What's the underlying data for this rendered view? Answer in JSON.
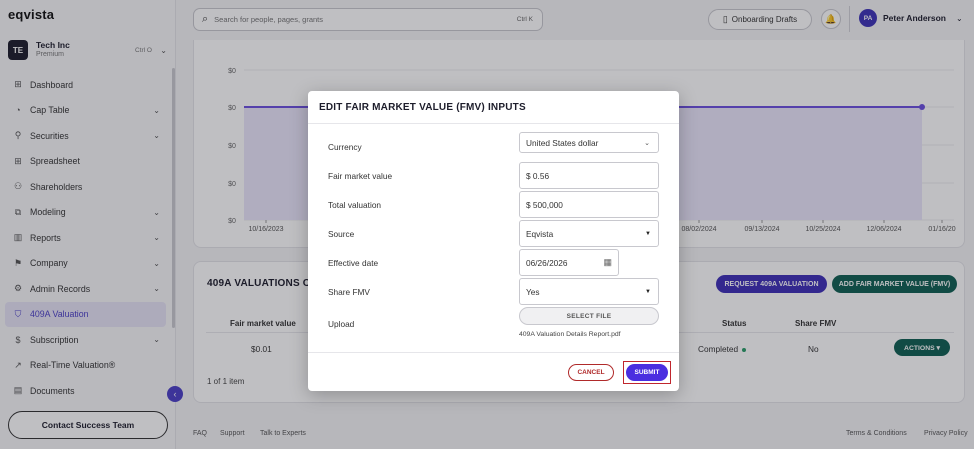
{
  "app": {
    "logo": "eqvista"
  },
  "company": {
    "initials": "TE",
    "name": "Tech Inc",
    "plan": "Premium",
    "shortcut": "Ctrl O"
  },
  "sidebar": {
    "items": [
      {
        "label": "Dashboard",
        "icon": "dashboard-icon",
        "glyph": "⊞",
        "expandable": false,
        "active": false
      },
      {
        "label": "Cap Table",
        "icon": "cap-table-icon",
        "glyph": "◔",
        "expandable": true,
        "active": false
      },
      {
        "label": "Securities",
        "icon": "securities-icon",
        "glyph": "⚲",
        "expandable": true,
        "active": false
      },
      {
        "label": "Spreadsheet",
        "icon": "spreadsheet-icon",
        "glyph": "⊞",
        "expandable": false,
        "active": false
      },
      {
        "label": "Shareholders",
        "icon": "shareholders-icon",
        "glyph": "⚇",
        "expandable": false,
        "active": false
      },
      {
        "label": "Modeling",
        "icon": "modeling-icon",
        "glyph": "⧉",
        "expandable": true,
        "active": false
      },
      {
        "label": "Reports",
        "icon": "reports-icon",
        "glyph": "▥",
        "expandable": true,
        "active": false
      },
      {
        "label": "Company",
        "icon": "company-icon",
        "glyph": "⚑",
        "expandable": true,
        "active": false
      },
      {
        "label": "Admin Records",
        "icon": "admin-records-icon",
        "glyph": "⚙",
        "expandable": true,
        "active": false
      },
      {
        "label": "409A Valuation",
        "icon": "shield-icon",
        "glyph": "⛉",
        "expandable": false,
        "active": true
      },
      {
        "label": "Subscription",
        "icon": "subscription-icon",
        "glyph": "$",
        "expandable": true,
        "active": false
      },
      {
        "label": "Real-Time Valuation®",
        "icon": "trend-icon",
        "glyph": "↗",
        "expandable": false,
        "active": false
      },
      {
        "label": "Documents",
        "icon": "documents-icon",
        "glyph": "▤",
        "expandable": false,
        "active": false
      }
    ],
    "contact_label": "Contact Success Team"
  },
  "header": {
    "search_placeholder": "Search for people, pages, grants",
    "search_shortcut": "Ctrl K",
    "drafts_label": "Onboarding Drafts",
    "user_initials": "PA",
    "user_name": "Peter Anderson"
  },
  "chart_data": {
    "type": "line",
    "x": [
      "10/16/2023",
      "08/02/2024",
      "09/13/2024",
      "10/25/2024",
      "12/06/2024",
      "01/16/20"
    ],
    "y_tick_labels": [
      "$0",
      "$0",
      "$0",
      "$0",
      "$0"
    ],
    "values": [
      0.01,
      0.01,
      0.01,
      0.01,
      0.01,
      0.01
    ],
    "color": "#6b4fe0",
    "fill": "#ebe7fb"
  },
  "valuations": {
    "title": "409A VALUATIONS OVE",
    "request_label": "REQUEST 409A VALUATION",
    "add_fmv_label": "ADD FAIR MARKET VALUE (FMV)",
    "columns": {
      "fmv": "Fair market value",
      "status": "Status",
      "share_fmv": "Share FMV"
    },
    "rows": [
      {
        "fmv": "$0.01",
        "status": "Completed",
        "share_fmv": "No",
        "actions": "ACTIONS ▾"
      }
    ],
    "count": "1 of 1 item"
  },
  "footer": {
    "faq": "FAQ",
    "support": "Support",
    "talk": "Talk to Experts",
    "terms": "Terms & Conditions",
    "privacy": "Privacy Policy"
  },
  "modal": {
    "title": "EDIT FAIR MARKET VALUE (FMV) INPUTS",
    "currency_label": "Currency",
    "currency_value": "United States dollar",
    "fmv_label": "Fair market value",
    "fmv_value": "$ 0.56",
    "total_label": "Total valuation",
    "total_value": "$ 500,000",
    "source_label": "Source",
    "source_value": "Eqvista",
    "date_label": "Effective date",
    "date_value": "06/26/2026",
    "share_fmv_label": "Share FMV",
    "share_fmv_value": "Yes",
    "upload_label": "Upload",
    "select_file_label": "SELECT FILE",
    "file_name": "409A Valuation Details Report.pdf",
    "cancel_label": "CANCEL",
    "submit_label": "SUBMIT"
  }
}
